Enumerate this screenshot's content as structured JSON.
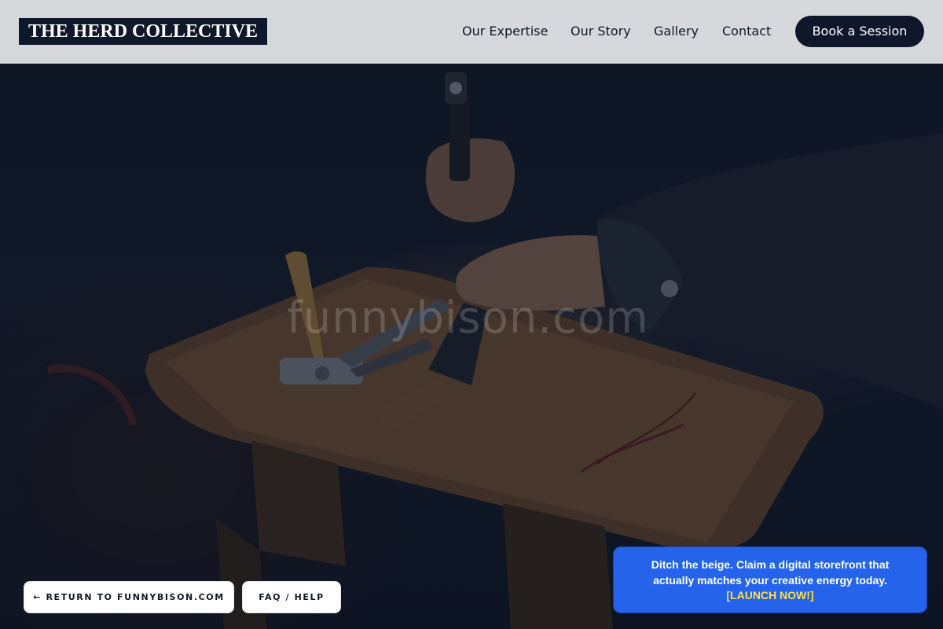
{
  "header": {
    "brand": "THE HERD COLLECTIVE",
    "nav": [
      "Our Expertise",
      "Our Story",
      "Gallery",
      "Contact"
    ],
    "cta": "Book a Session"
  },
  "hero": {
    "watermark": "funnybison.com",
    "image": "craftsman hands with hammer and tools on wooden workbench"
  },
  "footer_buttons": {
    "return": "← RETURN TO FUNNYBISON.COM",
    "faq": "FAQ / HELP"
  },
  "promo": {
    "text": "Ditch the beige. Claim a digital storefront that actually matches your creative energy today.",
    "link": "[LAUNCH NOW!]"
  },
  "colors": {
    "header_bg": "#d6d8dc",
    "brand_bg": "#0f172a",
    "promo_bg": "#2563eb",
    "promo_link": "#fde047"
  }
}
